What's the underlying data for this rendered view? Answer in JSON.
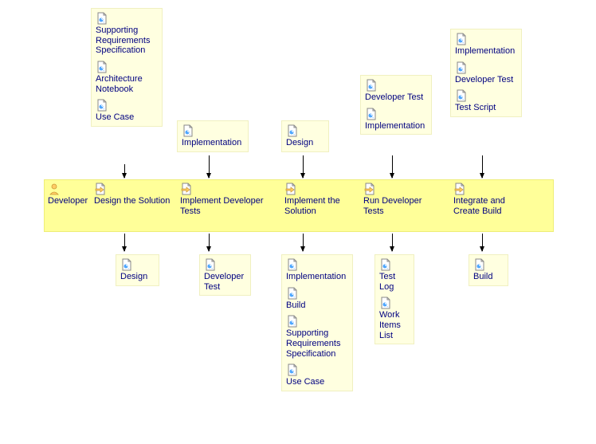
{
  "inputs": {
    "col1": [
      "Supporting Requirements Specification",
      "Architecture Notebook",
      "Use Case"
    ],
    "col2": [
      "Implementation"
    ],
    "col3": [
      "Design"
    ],
    "col4": [
      "Developer Test",
      "Implementation"
    ],
    "col5": [
      "Implementation",
      "Developer Test",
      "Test Script"
    ]
  },
  "swimlane": {
    "role": "Developer",
    "tasks": [
      "Design the Solution",
      "Implement Developer Tests",
      "Implement the Solution",
      "Run Developer Tests",
      "Integrate and Create Build"
    ]
  },
  "outputs": {
    "col1": [
      "Design"
    ],
    "col2": [
      "Developer Test"
    ],
    "col3": [
      "Implementation",
      "Build",
      "Supporting Requirements Specification",
      "Use Case"
    ],
    "col4": [
      "Test Log",
      "Work Items List"
    ],
    "col5": [
      "Build"
    ]
  }
}
